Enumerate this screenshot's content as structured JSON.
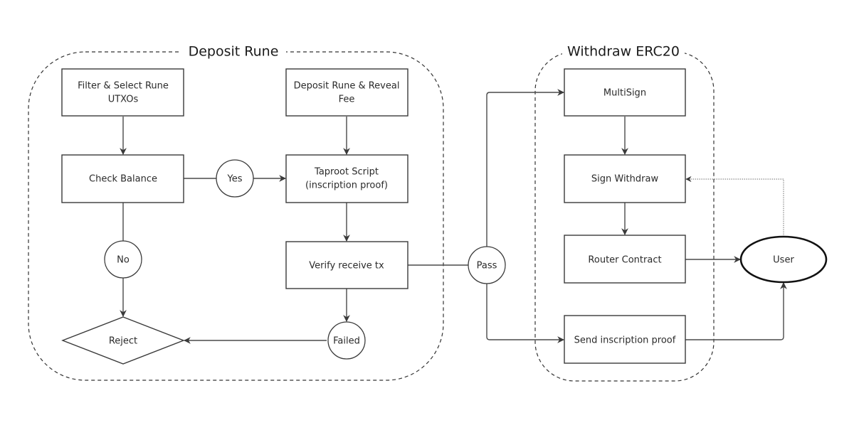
{
  "diagram": {
    "groups": {
      "deposit": {
        "title": "Deposit Rune"
      },
      "withdraw": {
        "title": "Withdraw ERC20"
      }
    },
    "nodes": {
      "filter_select": {
        "lines": [
          "Filter & Select Rune",
          "UTXOs"
        ],
        "shape": "rectangle"
      },
      "check_balance": {
        "lines": [
          "Check Balance"
        ],
        "shape": "rectangle"
      },
      "yes": {
        "lines": [
          "Yes"
        ],
        "shape": "circle"
      },
      "no": {
        "lines": [
          "No"
        ],
        "shape": "circle"
      },
      "reject": {
        "lines": [
          "Reject"
        ],
        "shape": "diamond"
      },
      "deposit_reveal": {
        "lines": [
          "Deposit Rune & Reveal",
          "Fee"
        ],
        "shape": "rectangle"
      },
      "taproot_script": {
        "lines": [
          "Taproot Script",
          "(inscription proof)"
        ],
        "shape": "rectangle"
      },
      "verify_receive": {
        "lines": [
          "Verify receive tx"
        ],
        "shape": "rectangle"
      },
      "failed": {
        "lines": [
          "Failed"
        ],
        "shape": "circle"
      },
      "pass": {
        "lines": [
          "Pass"
        ],
        "shape": "circle"
      },
      "multisign": {
        "lines": [
          "MultiSign"
        ],
        "shape": "rectangle"
      },
      "sign_withdraw": {
        "lines": [
          "Sign Withdraw"
        ],
        "shape": "rectangle"
      },
      "router_contract": {
        "lines": [
          "Router Contract"
        ],
        "shape": "rectangle"
      },
      "send_proof": {
        "lines": [
          "Send inscription proof"
        ],
        "shape": "rectangle"
      },
      "user": {
        "lines": [
          "User"
        ],
        "shape": "ellipse"
      }
    },
    "edges": [
      {
        "from": "filter_select",
        "to": "check_balance",
        "style": "solid"
      },
      {
        "from": "check_balance",
        "to": "yes",
        "style": "solid",
        "arrow": false
      },
      {
        "from": "yes",
        "to": "taproot_script",
        "style": "solid"
      },
      {
        "from": "check_balance",
        "to": "no",
        "style": "solid",
        "arrow": false
      },
      {
        "from": "no",
        "to": "reject",
        "style": "solid"
      },
      {
        "from": "deposit_reveal",
        "to": "taproot_script",
        "style": "solid"
      },
      {
        "from": "taproot_script",
        "to": "verify_receive",
        "style": "solid"
      },
      {
        "from": "verify_receive",
        "to": "failed",
        "style": "solid"
      },
      {
        "from": "failed",
        "to": "reject",
        "style": "solid"
      },
      {
        "from": "verify_receive",
        "to": "pass",
        "style": "solid",
        "arrow": false
      },
      {
        "from": "pass",
        "to": "multisign",
        "style": "solid"
      },
      {
        "from": "pass",
        "to": "send_proof",
        "style": "solid"
      },
      {
        "from": "multisign",
        "to": "sign_withdraw",
        "style": "solid"
      },
      {
        "from": "sign_withdraw",
        "to": "router_contract",
        "style": "solid"
      },
      {
        "from": "router_contract",
        "to": "user",
        "style": "solid"
      },
      {
        "from": "send_proof",
        "to": "user",
        "style": "solid"
      },
      {
        "from": "user",
        "to": "sign_withdraw",
        "style": "dotted"
      }
    ]
  }
}
